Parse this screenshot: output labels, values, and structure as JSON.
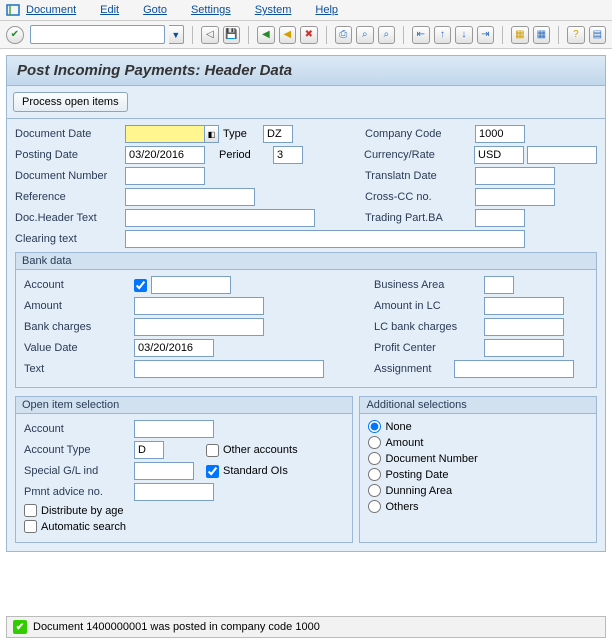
{
  "menu": [
    "Document",
    "Edit",
    "Goto",
    "Settings",
    "System",
    "Help"
  ],
  "title": "Post Incoming Payments: Header Data",
  "process_btn": "Process open items",
  "header_labels": {
    "doc_date": "Document Date",
    "type": "Type",
    "company_code": "Company Code",
    "posting_date": "Posting Date",
    "period": "Period",
    "currency_rate": "Currency/Rate",
    "doc_number": "Document Number",
    "translatn_date": "Translatn Date",
    "reference": "Reference",
    "cross_cc": "Cross-CC no.",
    "doc_header_text": "Doc.Header Text",
    "trading_part": "Trading Part.BA",
    "clearing_text": "Clearing text"
  },
  "header_values": {
    "type": "DZ",
    "company_code": "1000",
    "posting_date": "03/20/2016",
    "period": "3",
    "currency": "USD"
  },
  "bank_title": "Bank data",
  "bank_labels": {
    "account": "Account",
    "business_area": "Business Area",
    "amount": "Amount",
    "amount_lc": "Amount in LC",
    "bank_charges": "Bank charges",
    "lc_bank_charges": "LC bank charges",
    "value_date": "Value Date",
    "profit_center": "Profit Center",
    "text": "Text",
    "assignment": "Assignment"
  },
  "bank_values": {
    "value_date": "03/20/2016"
  },
  "ois_title": "Open item selection",
  "ois_labels": {
    "account": "Account",
    "account_type": "Account Type",
    "other_accounts": "Other accounts",
    "special_gl": "Special G/L ind",
    "standard_ois": "Standard OIs",
    "pmnt_advice": "Pmnt advice no.",
    "distribute": "Distribute by age",
    "auto_search": "Automatic search"
  },
  "ois_values": {
    "account_type": "D",
    "standard_ois_checked": true
  },
  "addsel_title": "Additional selections",
  "addsel_options": [
    "None",
    "Amount",
    "Document Number",
    "Posting Date",
    "Dunning Area",
    "Others"
  ],
  "addsel_selected": "None",
  "status": "Document 1400000001 was posted in company code 1000"
}
